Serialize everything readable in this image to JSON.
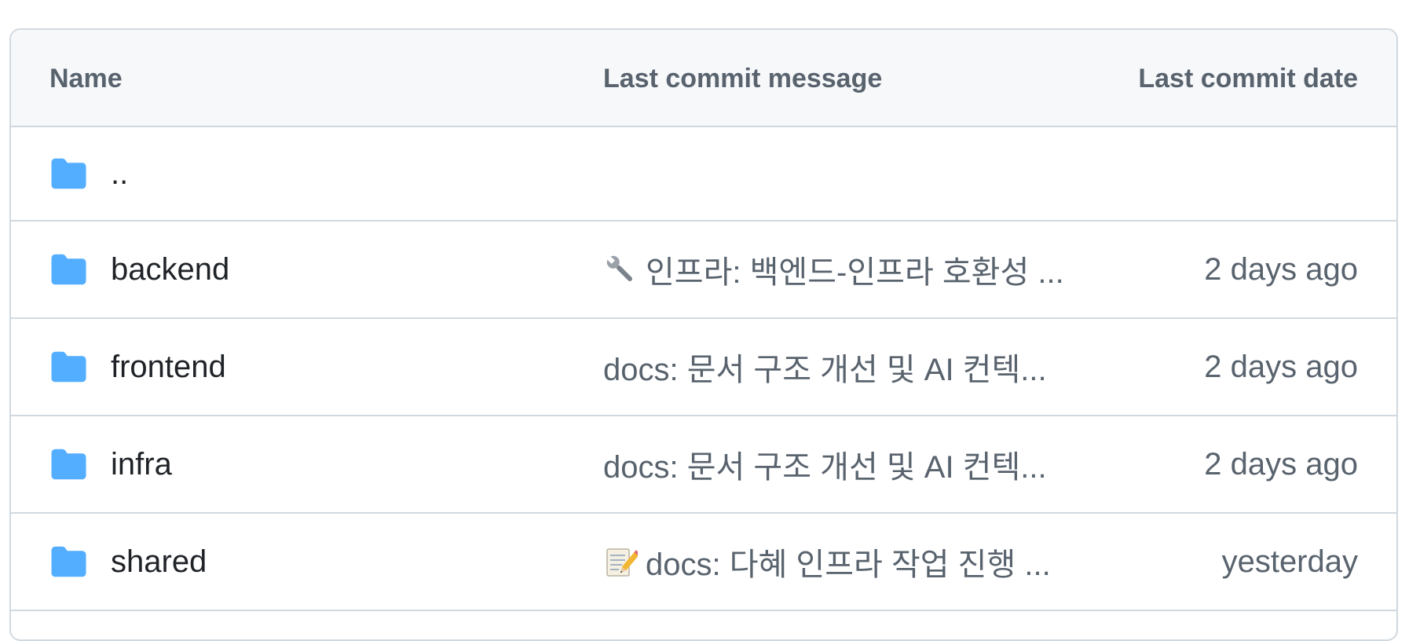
{
  "table": {
    "headers": {
      "name": "Name",
      "message": "Last commit message",
      "date": "Last commit date"
    },
    "parent_dir": "..",
    "rows": [
      {
        "name": "backend",
        "icon": "wrench-emoji",
        "message": "인프라: 백엔드-인프라 호환성 ...",
        "date": "2 days ago"
      },
      {
        "name": "frontend",
        "icon": "",
        "message": "docs: 문서 구조 개선 및 AI 컨텍...",
        "date": "2 days ago"
      },
      {
        "name": "infra",
        "icon": "",
        "message": "docs: 문서 구조 개선 및 AI 컨텍...",
        "date": "2 days ago"
      },
      {
        "name": "shared",
        "icon": "memo-emoji",
        "message": "docs: 다혜 인프라 작업 진행 ...",
        "date": "yesterday"
      }
    ]
  },
  "colors": {
    "folder": "#54aeff",
    "header_bg": "#f6f8fa",
    "border": "#d1d9e0",
    "muted_text": "#59636e",
    "text": "#1f2328"
  }
}
